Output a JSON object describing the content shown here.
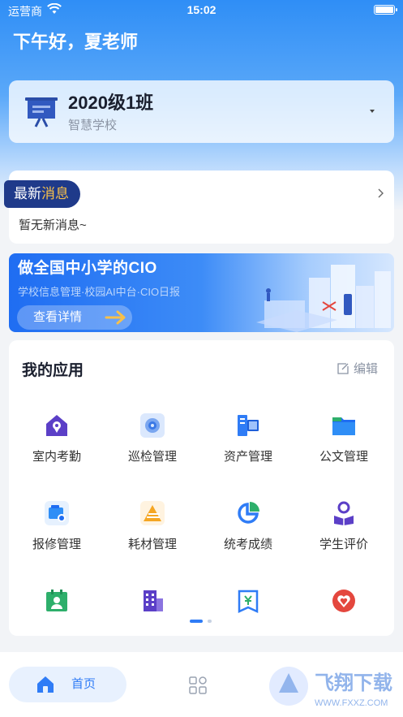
{
  "status_bar": {
    "carrier": "运营商",
    "time": "15:02"
  },
  "greeting": "下午好，夏老师",
  "class_card": {
    "class_name": "2020级1班",
    "school": "智慧学校"
  },
  "news": {
    "tag_prefix": "最新",
    "tag_highlight": "消息",
    "empty_text": "暂无新消息~"
  },
  "banner": {
    "title": "做全国中小学的CIO",
    "subtitle": "学校信息管理·校园AI中台·CIO日报",
    "button": "查看详情"
  },
  "apps": {
    "title": "我的应用",
    "edit_label": "编辑",
    "items": [
      {
        "label": "室内考勤",
        "icon": "house-location-icon",
        "color": "#5b3fc7"
      },
      {
        "label": "巡检管理",
        "icon": "inspection-icon",
        "color": "#3a78e6"
      },
      {
        "label": "资产管理",
        "icon": "asset-icon",
        "color": "#2f7cf6"
      },
      {
        "label": "公文管理",
        "icon": "folder-icon",
        "color": "#1f6df2"
      },
      {
        "label": "报修管理",
        "icon": "repair-icon",
        "color": "#2f8ef6"
      },
      {
        "label": "耗材管理",
        "icon": "materials-icon",
        "color": "#f5a623"
      },
      {
        "label": "统考成绩",
        "icon": "pie-chart-icon",
        "color": "#2f7cf6"
      },
      {
        "label": "学生评价",
        "icon": "student-reading-icon",
        "color": "#5b3fc7"
      },
      {
        "label": "",
        "icon": "calendar-person-icon",
        "color": "#2eaf6b"
      },
      {
        "label": "",
        "icon": "building-icon",
        "color": "#5b3fc7"
      },
      {
        "label": "",
        "icon": "finance-book-icon",
        "color": "#2f7cf6"
      },
      {
        "label": "",
        "icon": "heart-badge-icon",
        "color": "#e4473e"
      }
    ]
  },
  "tabbar": {
    "home_label": "首页"
  },
  "watermark": {
    "title": "飞翔下载",
    "url": "WWW.FXXZ.COM"
  }
}
